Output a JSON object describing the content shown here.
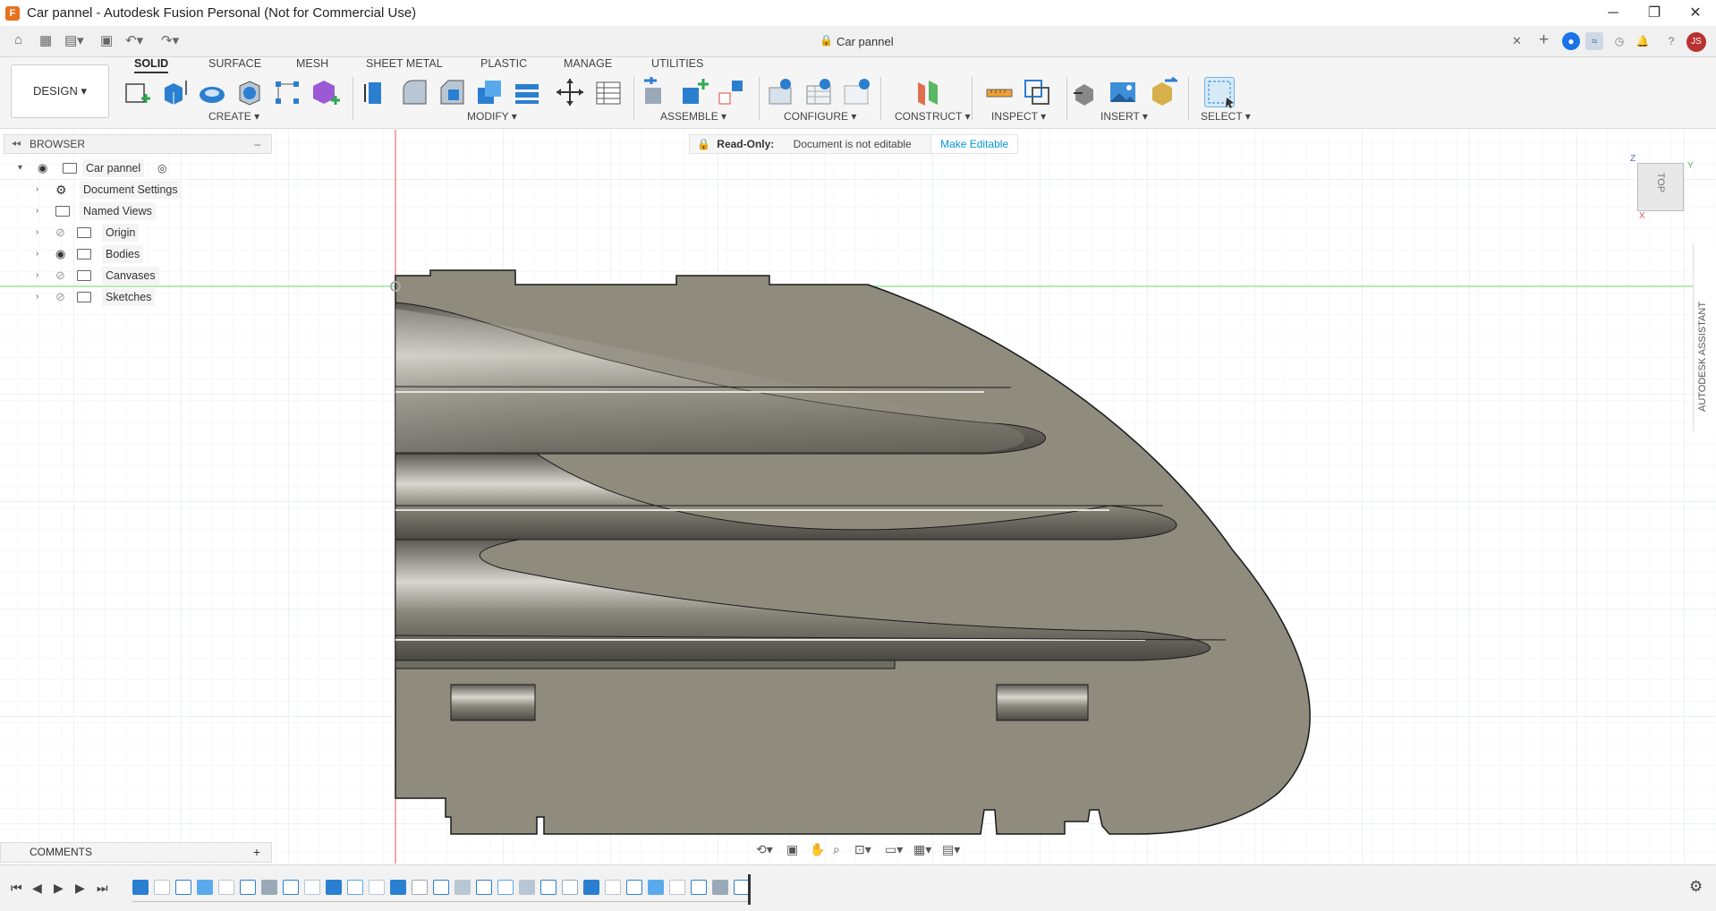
{
  "window": {
    "title": "Car pannel - Autodesk Fusion Personal (Not for Commercial Use)",
    "min": "─",
    "max": "❐",
    "close": "✕"
  },
  "tabbar": {
    "doc_tab": "Car pannel",
    "tab_close": "✕",
    "add_tab": "+",
    "user_initials": "JS"
  },
  "toolbar": {
    "workspace": "DESIGN ▾",
    "tabs": [
      "SOLID",
      "SURFACE",
      "MESH",
      "SHEET METAL",
      "PLASTIC",
      "MANAGE",
      "UTILITIES"
    ],
    "groups": [
      "CREATE ▾",
      "MODIFY ▾",
      "ASSEMBLE ▾",
      "CONFIGURE ▾",
      "CONSTRUCT ▾",
      "INSPECT ▾",
      "INSERT ▾",
      "SELECT ▾"
    ],
    "accent": "#0696d7"
  },
  "browser": {
    "header": "BROWSER",
    "collapse": "–",
    "root": "Car pannel",
    "items": [
      {
        "label": "Document Settings",
        "icon": "gear-icon"
      },
      {
        "label": "Named Views",
        "icon": "folder-icon"
      },
      {
        "label": "Origin",
        "icon": "folder-icon"
      },
      {
        "label": "Bodies",
        "icon": "folder-icon"
      },
      {
        "label": "Canvases",
        "icon": "folder-icon"
      },
      {
        "label": "Sketches",
        "icon": "folder-icon"
      }
    ]
  },
  "readonly": {
    "label": "Read-Only:",
    "message": "Document is not editable",
    "action": "Make Editable"
  },
  "viewcube": {
    "face": "TOP",
    "axis_z": "Z",
    "axis_y": "Y",
    "axis_x": "X"
  },
  "assistant": {
    "label": "AUTODESK ASSISTANT"
  },
  "comments": {
    "label": "COMMENTS",
    "add": "+"
  },
  "colors": {
    "part_fill": "#8f8b7d",
    "part_edge": "#1a1a1a",
    "grid": "#dde3ea",
    "axis_red": "#e56060",
    "axis_green": "#7fd87f"
  }
}
